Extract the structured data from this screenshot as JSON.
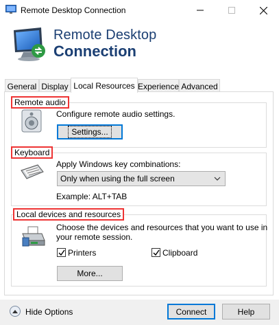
{
  "window": {
    "title": "Remote Desktop Connection",
    "icon": "remote-desktop-icon"
  },
  "banner": {
    "line1": "Remote Desktop",
    "line2": "Connection",
    "icon": "monitor-remote-icon",
    "color": "#1b3f73"
  },
  "tabs": [
    {
      "label": "General",
      "active": false
    },
    {
      "label": "Display",
      "active": false
    },
    {
      "label": "Local Resources",
      "active": true
    },
    {
      "label": "Experience",
      "active": false
    },
    {
      "label": "Advanced",
      "active": false
    }
  ],
  "remote_audio": {
    "label": "Remote audio",
    "description": "Configure remote audio settings.",
    "button": "Settings..."
  },
  "keyboard": {
    "label": "Keyboard",
    "description": "Apply Windows key combinations:",
    "selected": "Only when using the full screen",
    "example": "Example: ALT+TAB"
  },
  "local_devices": {
    "label": "Local devices and resources",
    "description_line1": "Choose the devices and resources that you want to use in",
    "description_line2": "your remote session.",
    "printers": {
      "label": "Printers",
      "checked": true
    },
    "clipboard": {
      "label": "Clipboard",
      "checked": true
    },
    "button": "More..."
  },
  "footer": {
    "hide_options": "Hide Options",
    "connect": "Connect",
    "help": "Help"
  },
  "colors": {
    "highlight_box": "#e33",
    "focus": "#0078d7"
  }
}
